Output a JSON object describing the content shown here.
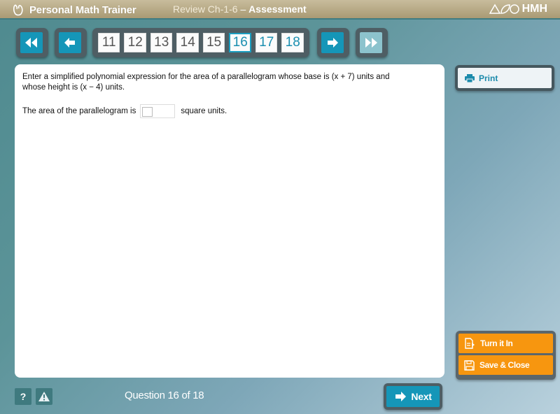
{
  "header": {
    "brand": "Personal Math Trainer",
    "assignment": "Review Ch-1-6",
    "separator": " – ",
    "mode": "Assessment",
    "publisher": "HMH"
  },
  "nav": {
    "first_icon": "double-chevron-left-icon",
    "prev_icon": "arrow-left-icon",
    "next_icon": "arrow-right-icon",
    "last_icon": "double-chevron-right-icon",
    "last_disabled": true,
    "questions": [
      "11",
      "12",
      "13",
      "14",
      "15",
      "16",
      "17",
      "18"
    ],
    "current": "16"
  },
  "question": {
    "prompt": "Enter a simplified polynomial expression for the area of a parallelogram whose base is (x + 7) units and whose height is (x − 4) units.",
    "answer_prefix": "The area of the parallelogram is",
    "answer_value": "",
    "answer_suffix": "square units."
  },
  "sidebar": {
    "print_label": "Print",
    "turn_in_label": "Turn it In",
    "save_close_label": "Save & Close"
  },
  "footer": {
    "help_label": "?",
    "question_counter": "Question 16 of 18",
    "next_label": "Next"
  },
  "colors": {
    "accent_blue": "#1596b8",
    "action_orange": "#f7960f",
    "header_tan": "#b8aa86"
  }
}
